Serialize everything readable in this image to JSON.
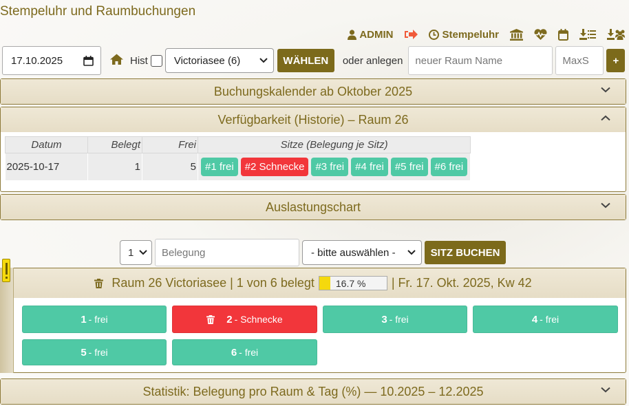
{
  "app": {
    "title": "Stempeluhr und Raumbuchungen"
  },
  "nav": {
    "admin_label": "ADMIN",
    "stempeluhr_label": "Stempeluhr",
    "icons": [
      "user-icon",
      "logout-icon",
      "clock-icon",
      "bank-icon",
      "heartbeat-icon",
      "calendar-icon",
      "download-list-icon",
      "download-users-icon"
    ]
  },
  "controls": {
    "date_value": "17.10.2025",
    "hist_label": "Hist",
    "hist_checked": false,
    "room_select": "Victoriasee (6)",
    "choose_button": "WÄHLEN",
    "or_create_label": "oder anlegen",
    "new_room_placeholder": "neuer Raum Name",
    "maxs_placeholder": "MaxS",
    "add_button": "+"
  },
  "panels": {
    "calendar_title": "Buchungskalender ab Oktober 2025",
    "history_title": "Verfügbarkeit (Historie) – Raum 26",
    "chart_title": "Auslastungschart",
    "stats_title": "Statistik: Belegung pro Raum & Tag (%) — 10.2025 – 12.2025"
  },
  "history_table": {
    "headers": [
      "Datum",
      "Belegt",
      "Frei",
      "Sitze (Belegung je Sitz)"
    ],
    "rows": [
      {
        "date": "2025-10-17",
        "belegt": "1",
        "frei": "5",
        "seats": [
          {
            "label": "#1 frei",
            "status": "free"
          },
          {
            "label": "#2 Schnecke",
            "status": "busy"
          },
          {
            "label": "#3 frei",
            "status": "free"
          },
          {
            "label": "#4 frei",
            "status": "free"
          },
          {
            "label": "#5 frei",
            "status": "free"
          },
          {
            "label": "#6 frei",
            "status": "free"
          }
        ]
      }
    ]
  },
  "booking": {
    "seat_number": "1",
    "belegung_placeholder": "Belegung",
    "pick_select": "- bitte auswählen -",
    "book_button": "SITZ BUCHEN"
  },
  "room": {
    "header_left": "Raum 26 Victoriasee | 1 von 6 belegt",
    "occupancy_percent": 16.7,
    "occupancy_label": "16.7 %",
    "header_right": "| Fr. 17. Okt. 2025, Kw 42",
    "seats": [
      {
        "num": "1",
        "text": "- frei",
        "status": "free"
      },
      {
        "num": "2",
        "text": "- Schnecke",
        "status": "busy"
      },
      {
        "num": "3",
        "text": "- frei",
        "status": "free"
      },
      {
        "num": "4",
        "text": "- frei",
        "status": "free"
      },
      {
        "num": "5",
        "text": "- frei",
        "status": "free"
      },
      {
        "num": "6",
        "text": "- frei",
        "status": "free"
      }
    ]
  },
  "colors": {
    "accent": "#7c6a1b",
    "free": "#4fc9a5",
    "busy": "#f2363b",
    "progress": "#f5d90d"
  }
}
